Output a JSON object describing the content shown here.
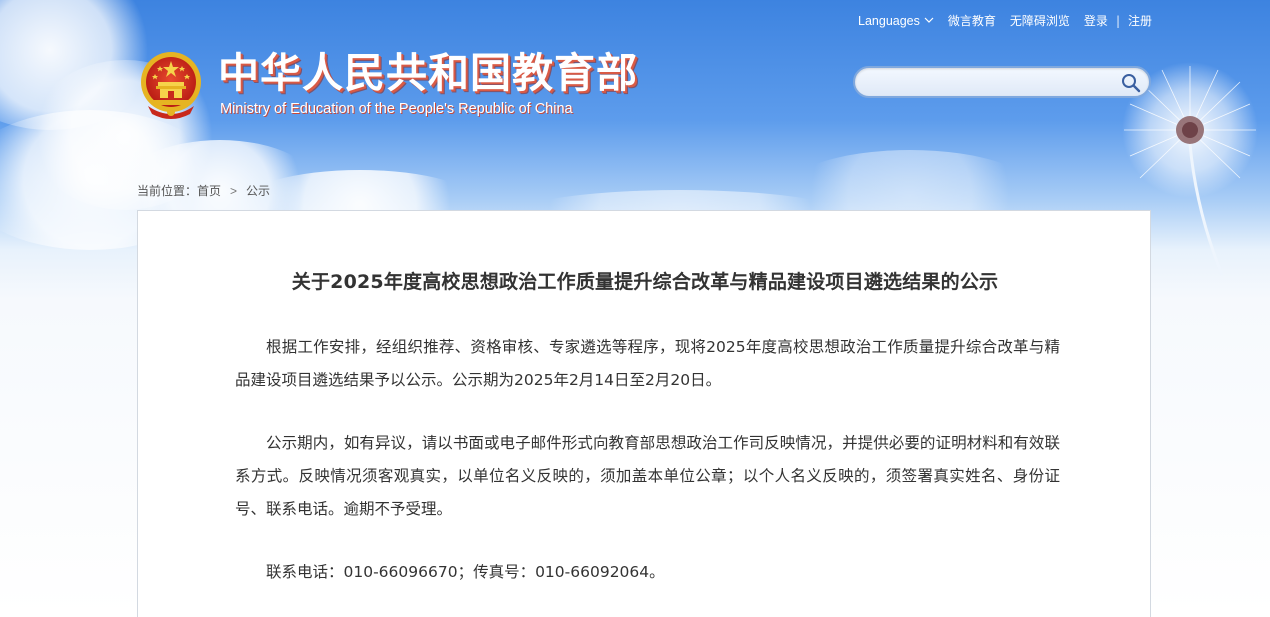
{
  "header": {
    "site_title": "中华人民共和国教育部",
    "site_subtitle": "Ministry of Education of the People's Republic of China",
    "top_links": {
      "languages": "Languages",
      "weiyan": "微言教育",
      "accessibility": "无障碍浏览",
      "login": "登录",
      "separator": "|",
      "register": "注册"
    },
    "search": {
      "value": "",
      "placeholder": ""
    }
  },
  "breadcrumb": {
    "prefix": "当前位置：",
    "home": "首页",
    "arrow": ">",
    "current": "公示"
  },
  "article": {
    "title": "关于2025年度高校思想政治工作质量提升综合改革与精品建设项目遴选结果的公示",
    "paragraphs": [
      "根据工作安排，经组织推荐、资格审核、专家遴选等程序，现将2025年度高校思想政治工作质量提升综合改革与精品建设项目遴选结果予以公示。公示期为2025年2月14日至2月20日。",
      "公示期内，如有异议，请以书面或电子邮件形式向教育部思想政治工作司反映情况，并提供必要的证明材料和有效联系方式。反映情况须客观真实，以单位名义反映的，须加盖本单位公章；以个人名义反映的，须签署真实姓名、身份证号、联系电话。逾期不予受理。",
      "联系电话：010-66096670；传真号：010-66092064。"
    ]
  },
  "colors": {
    "sky_top": "#3d83e0",
    "title_shadow": "#d95a45",
    "text": "#333333"
  },
  "icons": {
    "emblem": "national-emblem-icon",
    "search": "search-icon",
    "dropdown": "chevron-down-icon"
  }
}
